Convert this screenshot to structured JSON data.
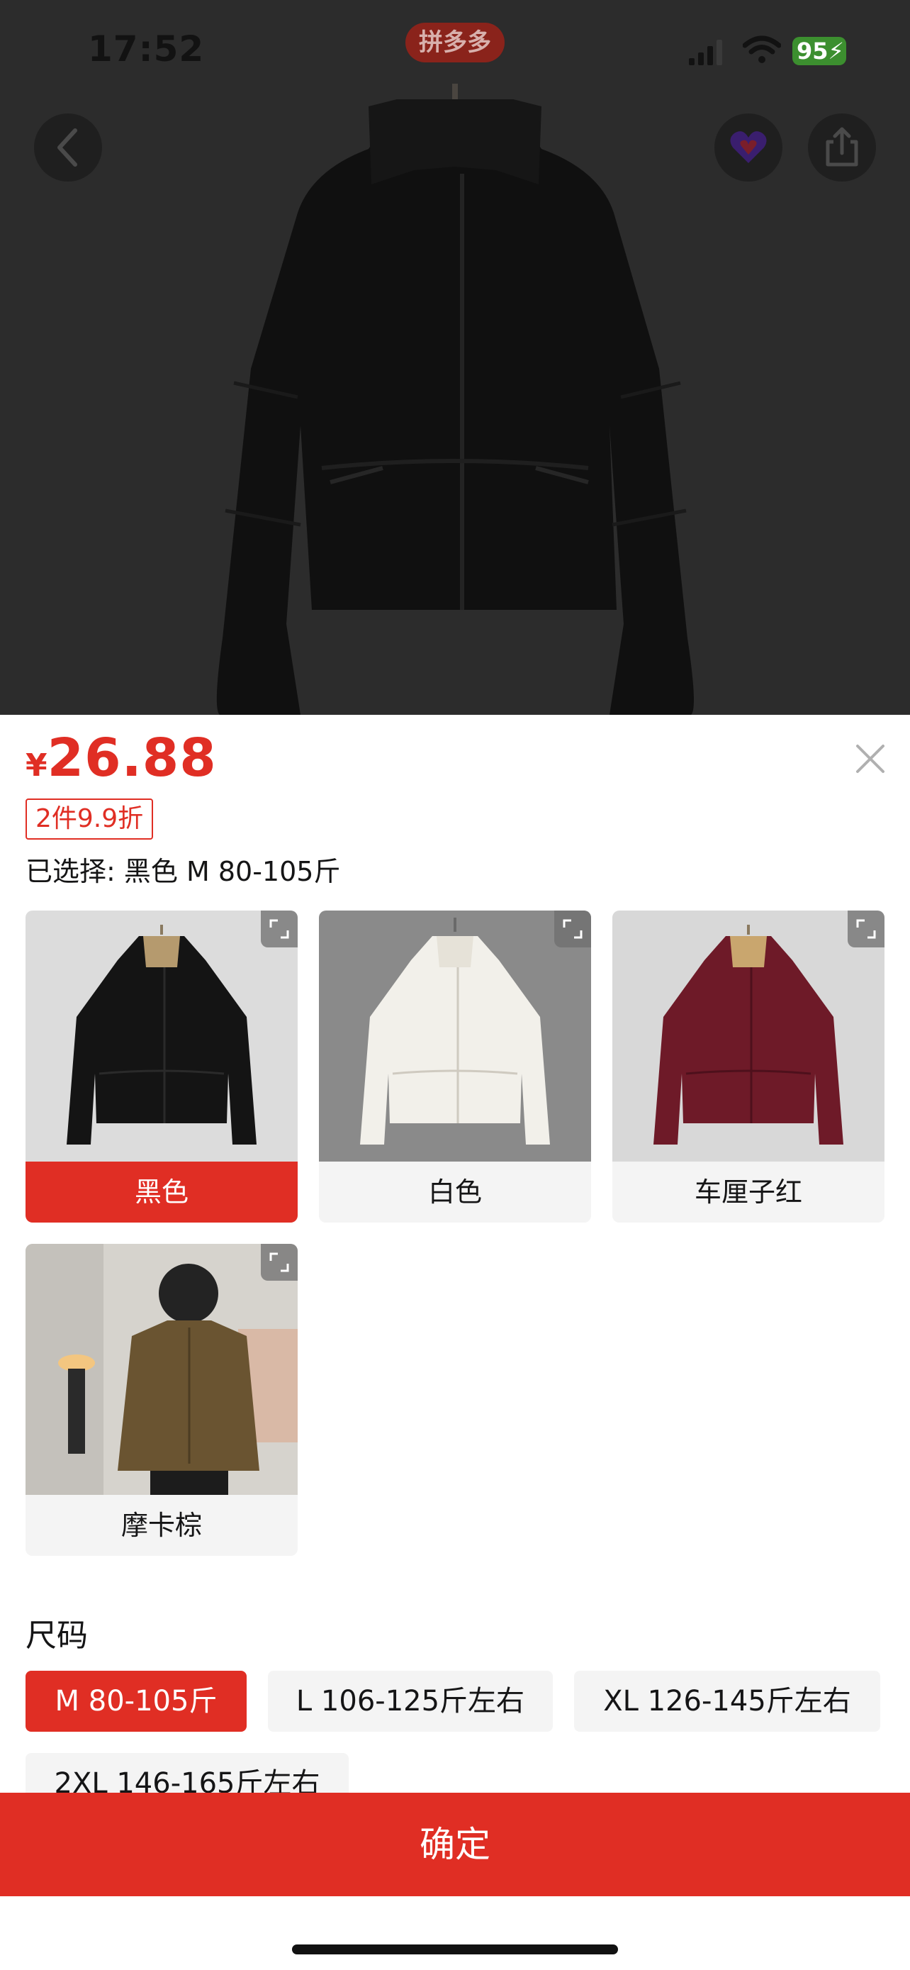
{
  "status_bar": {
    "time": "17:52",
    "app_badge": "拼多多",
    "battery": "95"
  },
  "top_nav": {
    "back_icon": "chevron-left-icon",
    "fav_icon": "heart-icon",
    "share_icon": "share-icon"
  },
  "sku_sheet": {
    "currency": "¥",
    "price": "26.88",
    "promo_tag": "2件9.9折",
    "selected_prefix": "已选择:",
    "selected_value": "黑色 M 80-105斤",
    "colors": [
      {
        "label": "黑色",
        "selected": true,
        "swatch": "#141414"
      },
      {
        "label": "白色",
        "selected": false,
        "swatch": "#f2f0ea"
      },
      {
        "label": "车厘子红",
        "selected": false,
        "swatch": "#6e1a28"
      },
      {
        "label": "摩卡棕",
        "selected": false,
        "swatch": "#6a5431"
      }
    ],
    "size_heading": "尺码",
    "sizes": [
      {
        "label": "M 80-105斤",
        "selected": true
      },
      {
        "label": "L 106-125斤左右",
        "selected": false
      },
      {
        "label": "XL 126-145斤左右",
        "selected": false
      },
      {
        "label": "2XL 146-165斤左右",
        "selected": false
      }
    ],
    "confirm_label": "确定"
  },
  "colors": {
    "accent": "#e02e24",
    "chip_bg": "#f4f4f4",
    "overlay": "#2c2c2c"
  }
}
